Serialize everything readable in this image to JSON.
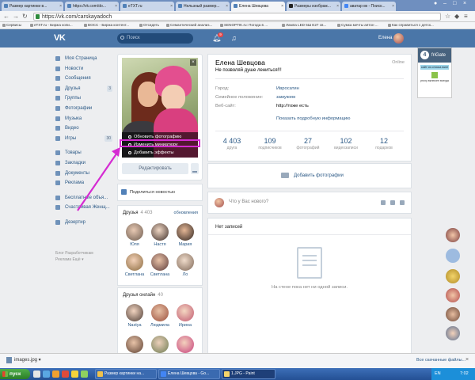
{
  "browser": {
    "tabs": [
      {
        "label": "Размер картинки в..."
      },
      {
        "label": "https://vk.com/do..."
      },
      {
        "label": "eTXT.ru"
      },
      {
        "label": "Нельзный размер..."
      },
      {
        "label": "Елена Шевцова",
        "active": true
      },
      {
        "label": "Размеры изобрaж..."
      },
      {
        "label": "аватар вк - Поиск..."
      }
    ],
    "url": "https://vk.com/carskayadoch",
    "bookmarks": [
      "Сервисы",
      "eTXT.ru - Биржа копи...",
      "BOCC - Биржа контент...",
      "Отсидеть",
      "Семантический анализ...",
      "SENOPTIK.ru: Погода в ...",
      "Лампа LED 5Ш E27 св...",
      "Сумка мечты аятон ...",
      "Как справиться с детск..."
    ]
  },
  "vk_header": {
    "logo": "VK",
    "search_placeholder": "Поиск",
    "notification_count": "9",
    "user_name": "Елена"
  },
  "left_menu": {
    "items": [
      {
        "label": "Моя Страница"
      },
      {
        "label": "Новости"
      },
      {
        "label": "Сообщения"
      },
      {
        "label": "Друзья",
        "count": "3"
      },
      {
        "label": "Группы"
      },
      {
        "label": "Фотографии"
      },
      {
        "label": "Музыка"
      },
      {
        "label": "Видео"
      },
      {
        "label": "Игры",
        "count": "30"
      }
    ],
    "items2": [
      {
        "label": "Товары"
      },
      {
        "label": "Закладки"
      },
      {
        "label": "Документы"
      },
      {
        "label": "Реклама"
      }
    ],
    "items3": [
      {
        "label": "Бесплатные объя..."
      },
      {
        "label": "Счастливая Женщ..."
      }
    ],
    "items4": [
      {
        "label": "Дезертир"
      }
    ],
    "footer_line1": "Блог   Разработчикам",
    "footer_line2": "Реклама  Ещё ▾"
  },
  "photo_menu": {
    "update_photo": "Обновить фотографию",
    "change_thumbnail": "Изменить миниатюру",
    "add_effects": "Добавить эффекты",
    "edit_button": "Редактировать"
  },
  "share": {
    "label": "Поделиться новостью"
  },
  "friends": {
    "title": "Друзья",
    "count": "4 403",
    "updates": "обновления",
    "items": [
      {
        "name": "Юля"
      },
      {
        "name": "Настя"
      },
      {
        "name": "Мария"
      },
      {
        "name": "Светлана"
      },
      {
        "name": "Светлана"
      },
      {
        "name": "Ло"
      }
    ]
  },
  "friends_online": {
    "title": "Друзья онлайн",
    "count": "40",
    "items": [
      {
        "name": "Nastya"
      },
      {
        "name": "Людмила"
      },
      {
        "name": "Ирина"
      }
    ]
  },
  "profile": {
    "name": "Елена Шевцова",
    "status": "Не позволяй душе лениться!!!",
    "online": "Online",
    "city_label": "Город:",
    "city_value": "Ивросатин",
    "family_label": "Семейное положение:",
    "family_value": "замужем",
    "website_label": "Веб-сайт:",
    "website_value": "http://тоже есть",
    "more_link": "Показать подробную информацию",
    "stats": [
      {
        "value": "4 403",
        "label": "друга"
      },
      {
        "value": "109",
        "label": "подписчиков"
      },
      {
        "value": "27",
        "label": "фотографий"
      },
      {
        "value": "102",
        "label": "видеозаписи"
      },
      {
        "value": "12",
        "label": "подарков"
      }
    ]
  },
  "add_photo": {
    "label": "Добавить фотографии"
  },
  "post": {
    "placeholder": "Что у Вас нового?"
  },
  "wall": {
    "title": "Нет записей",
    "empty": "На стене пока нет ни одной записи."
  },
  "frigate": {
    "name": "friGate",
    "bar": "сайт из списка вкпе",
    "text": "proxy включен всегда"
  },
  "downloads": {
    "file": "images.jpg",
    "show_all": "Все скачанные файлы..."
  },
  "taskbar": {
    "start": "пуск",
    "tasks": [
      {
        "label": "Размер картинки на..."
      },
      {
        "label": "Елена Шевцова - Go..."
      },
      {
        "label": "1.JPG - Paint",
        "active": true
      }
    ],
    "lang": "EN",
    "clock": "7:02"
  },
  "colors": {
    "vk_blue": "#4a76a8",
    "link": "#2a5885",
    "highlight": "#d52bd2"
  }
}
